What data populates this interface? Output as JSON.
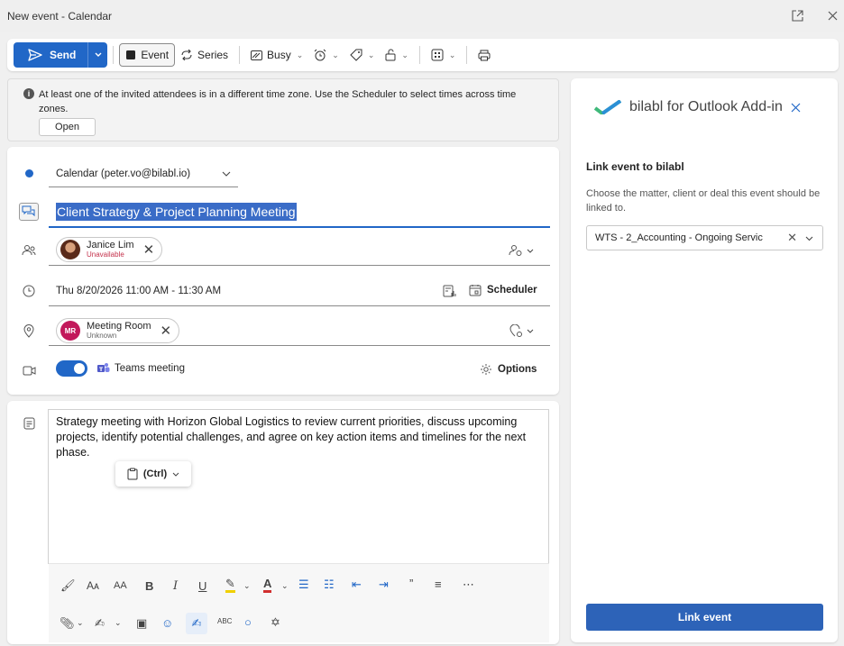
{
  "window": {
    "title": "New event - Calendar"
  },
  "toolbar": {
    "send_label": "Send",
    "event_label": "Event",
    "series_label": "Series",
    "busy_label": "Busy"
  },
  "infobar": {
    "message": "At least one of the invited attendees is in a different time zone. Use the Scheduler to select times across time zones.",
    "open_label": "Open"
  },
  "event": {
    "calendar": "Calendar (peter.vo@bilabl.io)",
    "title": "Client Strategy & Project Planning Meeting",
    "attendee": {
      "name": "Janice Lim",
      "status": "Unavailable"
    },
    "datetime": "Thu 8/20/2026 11:00 AM - 11:30 AM",
    "scheduler_label": "Scheduler",
    "location": {
      "initials": "MR",
      "name": "Meeting Room",
      "status": "Unknown"
    },
    "teams_label": "Teams meeting",
    "options_label": "Options",
    "body": "Strategy meeting with Horizon Global Logistics to review current priorities, discuss upcoming projects, identify potential challenges, and agree on key action items and timelines for the next phase.",
    "paste_label": "(Ctrl)"
  },
  "addin": {
    "title": "bilabl for Outlook Add-in",
    "heading": "Link event to bilabl",
    "description": "Choose the matter, client or deal this event should be linked to.",
    "selected": "WTS - 2_Accounting - Ongoing Servic",
    "button": "Link event"
  },
  "colors": {
    "accent": "#2167c7",
    "brand_green": "#3fb97a",
    "unavailable": "#c4314b"
  }
}
